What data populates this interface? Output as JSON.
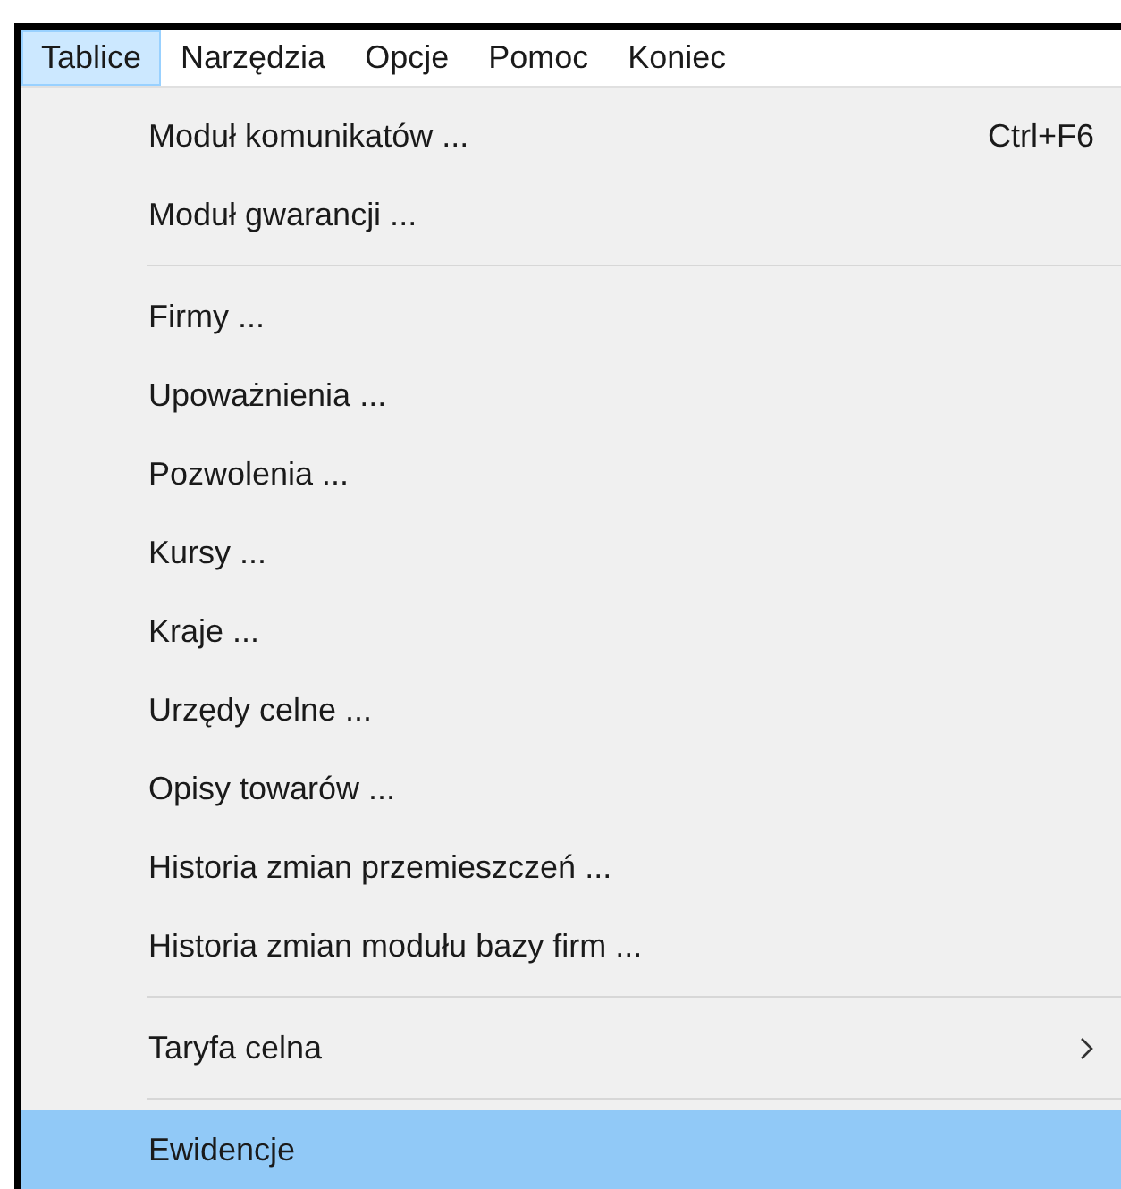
{
  "menu_bar": [
    {
      "label": "Tablice",
      "selected": true
    },
    {
      "label": "Narzędzia",
      "selected": false
    },
    {
      "label": "Opcje",
      "selected": false
    },
    {
      "label": "Pomoc",
      "selected": false
    },
    {
      "label": "Koniec",
      "selected": false
    }
  ],
  "menu": {
    "items": [
      {
        "kind": "item",
        "label": "Moduł komunikatów ...",
        "shortcut": "Ctrl+F6",
        "submenu": false,
        "selected": false
      },
      {
        "kind": "item",
        "label": "Moduł gwarancji ...",
        "submenu": false,
        "selected": false
      },
      {
        "kind": "separator"
      },
      {
        "kind": "item",
        "label": "Firmy ...",
        "submenu": false,
        "selected": false
      },
      {
        "kind": "item",
        "label": "Upoważnienia ...",
        "submenu": false,
        "selected": false
      },
      {
        "kind": "item",
        "label": "Pozwolenia ...",
        "submenu": false,
        "selected": false
      },
      {
        "kind": "item",
        "label": "Kursy ...",
        "submenu": false,
        "selected": false
      },
      {
        "kind": "item",
        "label": "Kraje ...",
        "submenu": false,
        "selected": false
      },
      {
        "kind": "item",
        "label": "Urzędy celne ...",
        "submenu": false,
        "selected": false
      },
      {
        "kind": "item",
        "label": "Opisy towarów ...",
        "submenu": false,
        "selected": false
      },
      {
        "kind": "item",
        "label": "Historia zmian przemieszczeń ...",
        "submenu": false,
        "selected": false
      },
      {
        "kind": "item",
        "label": "Historia zmian modułu bazy firm ...",
        "submenu": false,
        "selected": false
      },
      {
        "kind": "separator"
      },
      {
        "kind": "item",
        "label": "Taryfa celna",
        "submenu": true,
        "selected": false
      },
      {
        "kind": "separator"
      },
      {
        "kind": "item",
        "label": "Ewidencje",
        "submenu": false,
        "selected": true
      }
    ]
  }
}
